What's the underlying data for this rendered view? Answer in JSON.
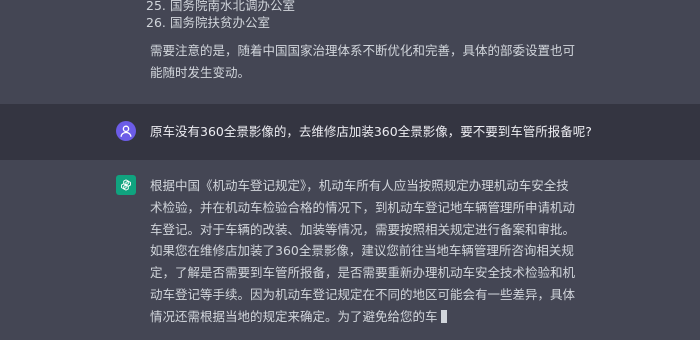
{
  "top": {
    "list": [
      {
        "num": "25.",
        "text": "国务院南水北调办公室"
      },
      {
        "num": "26.",
        "text": "国务院扶贫办公室"
      }
    ],
    "note": "需要注意的是，随着中国国家治理体系不断优化和完善，具体的部委设置也可能随时发生变动。"
  },
  "user": {
    "avatar_icon": "user-avatar-icon",
    "message": "原车没有360全景影像的，去维修店加装360全景影像，要不要到车管所报备呢?"
  },
  "assistant": {
    "avatar_icon": "chatgpt-logo-icon",
    "paragraph1": "根据中国《机动车登记规定》，机动车所有人应当按照规定办理机动车安全技术检验，并在机动车检验合格的情况下，到机动车登记地车辆管理所申请机动车登记。对于车辆的改装、加装等情况，需要按照相关规定进行备案和审批。",
    "paragraph2": "如果您在维修店加装了360全景影像，建议您前往当地车辆管理所咨询相关规定，了解是否需要到车管所报备，是否需要重新办理机动车安全技术检验和机动车登记等手续。因为机动车登记规定在不同的地区可能会有一些差异，具体情况还需根据当地的规定来确定。为了避免给您的车"
  },
  "colors": {
    "assistant_bg": "#444654",
    "user_bg": "#343541",
    "user_avatar": "#6c5ce7",
    "gpt_avatar": "#10a37f"
  }
}
